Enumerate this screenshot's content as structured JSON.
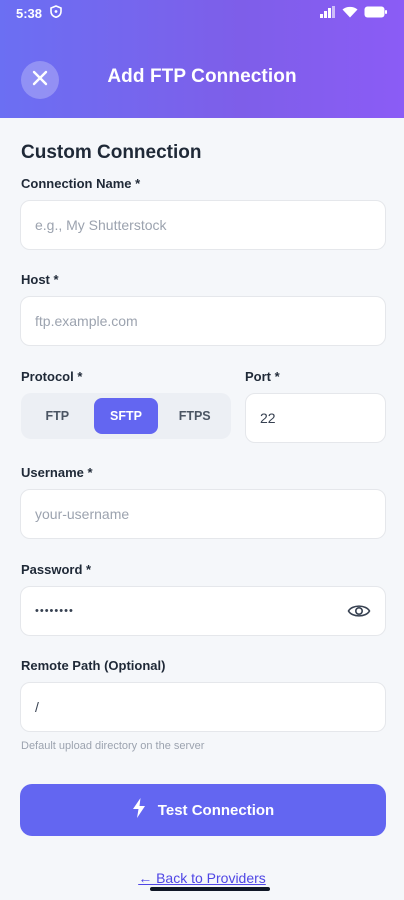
{
  "status_bar": {
    "time": "5:38"
  },
  "header": {
    "title": "Add FTP Connection"
  },
  "form": {
    "section_title": "Custom Connection",
    "connection_name": {
      "label": "Connection Name *",
      "placeholder": "e.g., My Shutterstock"
    },
    "host": {
      "label": "Host *",
      "placeholder": "ftp.example.com"
    },
    "protocol": {
      "label": "Protocol *",
      "options": [
        "FTP",
        "SFTP",
        "FTPS"
      ],
      "selected": "SFTP"
    },
    "port": {
      "label": "Port *",
      "value": "22"
    },
    "username": {
      "label": "Username *",
      "placeholder": "your-username"
    },
    "password": {
      "label": "Password *",
      "value": "••••••••"
    },
    "remote_path": {
      "label": "Remote Path (Optional)",
      "value": "/",
      "hint": "Default upload directory on the server"
    }
  },
  "actions": {
    "test_label": "Test Connection",
    "back_label": "← Back to Providers"
  },
  "colors": {
    "accent": "#6366f1",
    "header_gradient_start": "#6b6ff3",
    "header_gradient_end": "#8b5cf6"
  },
  "icons": [
    "close-icon",
    "bolt-icon",
    "eye-icon",
    "shield-icon",
    "signal-icon",
    "wifi-icon",
    "battery-icon"
  ]
}
